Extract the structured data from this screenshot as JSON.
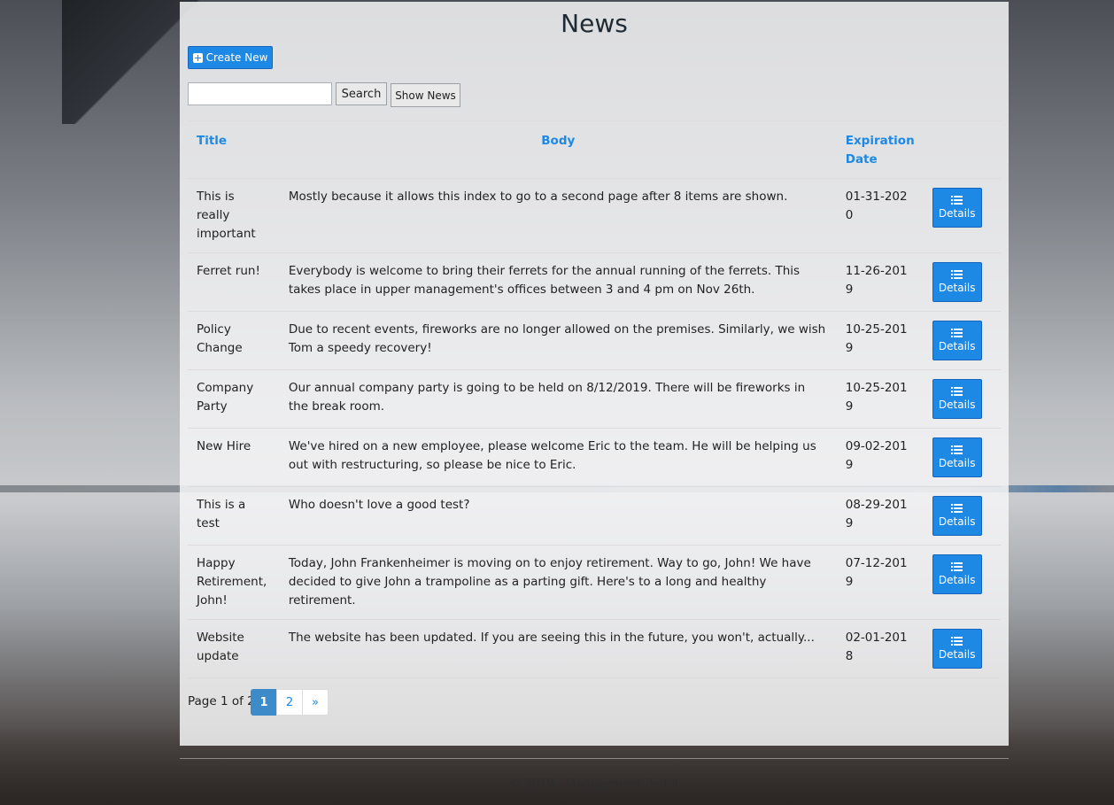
{
  "page": {
    "title": "News",
    "create_label": "Create New",
    "search_placeholder": "",
    "search_label": "Search",
    "show_label": "Show News"
  },
  "table": {
    "headers": {
      "title": "Title",
      "body": "Body",
      "date": "Expiration Date"
    },
    "details_label": "Details",
    "rows": [
      {
        "title": "This is really important",
        "body": "Mostly because it allows this index to go to a second page after 8 items are shown.",
        "date": "01-31-2020"
      },
      {
        "title": "Ferret run!",
        "body": "Everybody is welcome to bring their ferrets for the annual running of the ferrets. This takes place in upper management's offices between 3 and 4 pm on Nov 26th.",
        "date": "11-26-2019"
      },
      {
        "title": "Policy Change",
        "body": "Due to recent events, fireworks are no longer allowed on the premises. Similarly, we wish Tom a speedy recovery!",
        "date": "10-25-2019"
      },
      {
        "title": "Company Party",
        "body": "Our annual company party is going to be held on 8/12/2019. There will be fireworks in the break room.",
        "date": "10-25-2019"
      },
      {
        "title": "New Hire",
        "body": "We've hired on a new employee, please welcome Eric to the team. He will be helping us out with restructuring, so please be nice to Eric.",
        "date": "09-02-2019"
      },
      {
        "title": "This is a test",
        "body": "Who doesn't love a good test?",
        "date": "08-29-2019"
      },
      {
        "title": "Happy Retirement, John!",
        "body": "Today, John Frankenheimer is moving on to enjoy retirement. Way to go, John! We have decided to give John a trampoline as a parting gift. Here's to a long and healthy retirement.",
        "date": "07-12-2019"
      },
      {
        "title": "Website update",
        "body": "The website has been updated. If you are seeing this in the future, you won't, actually...",
        "date": "02-01-2018"
      }
    ]
  },
  "pagination": {
    "label": "Page 1 of 2",
    "pages": [
      "1",
      "2"
    ],
    "next": "»",
    "current": "1"
  },
  "footer": {
    "text": "© 2019 - Management Portal"
  },
  "colors": {
    "accent": "#1e88e5",
    "active_page": "#3d8bc9"
  }
}
